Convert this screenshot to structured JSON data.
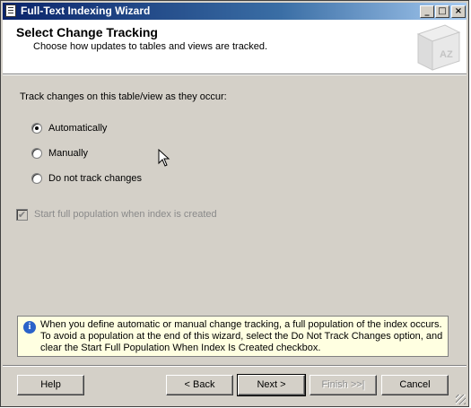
{
  "window": {
    "title": "Full-Text Indexing Wizard",
    "controls": {
      "minimize": "_",
      "maximize": "□",
      "close": "×"
    }
  },
  "header": {
    "title": "Select Change Tracking",
    "subtitle": "Choose how updates to tables and views are tracked.",
    "art_label": "AZ"
  },
  "form": {
    "prompt": "Track changes on this table/view as they occur:",
    "options": [
      {
        "label": "Automatically",
        "selected": true
      },
      {
        "label": "Manually",
        "selected": false
      },
      {
        "label": "Do not track changes",
        "selected": false
      }
    ],
    "start_population": {
      "label": "Start full population when index is created",
      "checked": true,
      "enabled": false
    }
  },
  "info": {
    "icon": "info-icon",
    "text": "When you define automatic or manual change tracking, a full population of the index occurs. To avoid a population at the end of this wizard, select the Do Not Track Changes option, and clear the Start Full Population When Index Is Created checkbox."
  },
  "buttons": {
    "help": "Help",
    "back": "< Back",
    "next": "Next >",
    "finish": "Finish >>|",
    "cancel": "Cancel"
  },
  "colors": {
    "dialog_bg": "#d4d0c8",
    "title_bar": "#0a246a",
    "info_bg": "#ffffe1"
  }
}
